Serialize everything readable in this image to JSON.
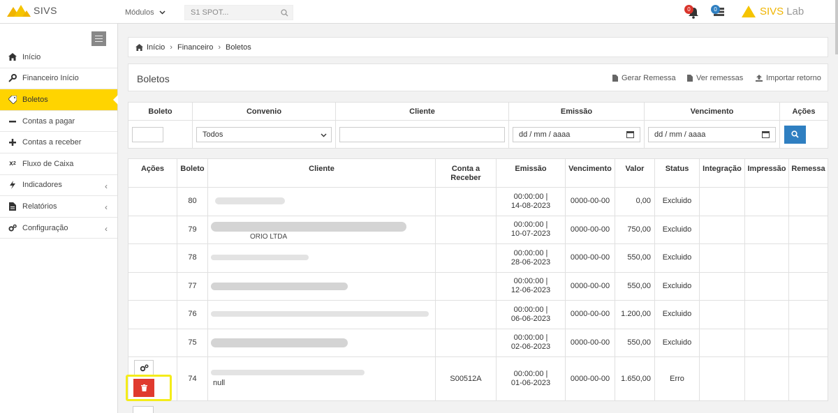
{
  "topbar": {
    "app_name": "SIVS",
    "modulos_label": "Módulos",
    "search_placeholder": "S1 SPOT...",
    "notif_count": "0",
    "tasks_count": "0",
    "brand_a": "SIVS",
    "brand_b": "Lab",
    "brand_color": "#f0b400"
  },
  "sidebar": {
    "items": [
      {
        "label": "Início",
        "icon": "home-icon"
      },
      {
        "label": "Financeiro Início",
        "icon": "wrench-icon"
      },
      {
        "label": "Boletos",
        "icon": "tag-icon",
        "active": true
      },
      {
        "label": "Contas a pagar",
        "icon": "minus-icon"
      },
      {
        "label": "Contas a receber",
        "icon": "plus-icon"
      },
      {
        "label": "Fluxo de Caixa",
        "icon": "x2-icon"
      },
      {
        "label": "Indicadores",
        "icon": "bolt-icon"
      },
      {
        "label": "Relatórios",
        "icon": "file-icon"
      },
      {
        "label": "Configuração",
        "icon": "cogs-icon"
      }
    ]
  },
  "breadcrumb": {
    "home": "Início",
    "level1": "Financeiro",
    "level2": "Boletos"
  },
  "page": {
    "title": "Boletos",
    "gerar_remessa": "Gerar Remessa",
    "ver_remessas": "Ver remessas",
    "importar_retorno": "Importar retorno"
  },
  "filters": {
    "headers": [
      "Boleto",
      "Convenio",
      "Cliente",
      "Emissão",
      "Vencimento",
      "Ações"
    ],
    "convenio_value": "Todos",
    "emissao_placeholder": "dd / mm / aaaa",
    "vencimento_placeholder": "dd / mm / aaaa"
  },
  "table": {
    "headers": [
      "Ações",
      "Boleto",
      "Cliente",
      "Conta a Receber",
      "Emissão",
      "Vencimento",
      "Valor",
      "Status",
      "Integração",
      "Impressão",
      "Remessa"
    ],
    "rows": [
      {
        "boleto": "80",
        "cliente_visible": "",
        "conta": "",
        "emissao_t": "00:00:00 |",
        "emissao_d": "14-08-2023",
        "vencimento": "0000-00-00",
        "valor": "0,00",
        "status": "Excluido"
      },
      {
        "boleto": "79",
        "cliente_visible": "ORIO LTDA",
        "conta": "",
        "emissao_t": "00:00:00 |",
        "emissao_d": "10-07-2023",
        "vencimento": "0000-00-00",
        "valor": "750,00",
        "status": "Excluido"
      },
      {
        "boleto": "78",
        "cliente_visible": "",
        "conta": "",
        "emissao_t": "00:00:00 |",
        "emissao_d": "28-06-2023",
        "vencimento": "0000-00-00",
        "valor": "550,00",
        "status": "Excluido"
      },
      {
        "boleto": "77",
        "cliente_visible": "",
        "conta": "",
        "emissao_t": "00:00:00 |",
        "emissao_d": "12-06-2023",
        "vencimento": "0000-00-00",
        "valor": "550,00",
        "status": "Excluido"
      },
      {
        "boleto": "76",
        "cliente_visible": "",
        "conta": "",
        "emissao_t": "00:00:00 |",
        "emissao_d": "06-06-2023",
        "vencimento": "0000-00-00",
        "valor": "1.200,00",
        "status": "Excluido"
      },
      {
        "boleto": "75",
        "cliente_visible": "",
        "conta": "",
        "emissao_t": "00:00:00 |",
        "emissao_d": "02-06-2023",
        "vencimento": "0000-00-00",
        "valor": "550,00",
        "status": "Excluido"
      },
      {
        "boleto": "74",
        "cliente_visible": "null",
        "conta": "S00512A",
        "emissao_t": "00:00:00 |",
        "emissao_d": "01-06-2023",
        "vencimento": "0000-00-00",
        "valor": "1.650,00",
        "status": "Erro"
      }
    ]
  },
  "colors": {
    "accent": "#ffd400",
    "primary_button": "#2f7fc1",
    "danger": "#e03a2e",
    "highlight": "#f4ec1a"
  }
}
